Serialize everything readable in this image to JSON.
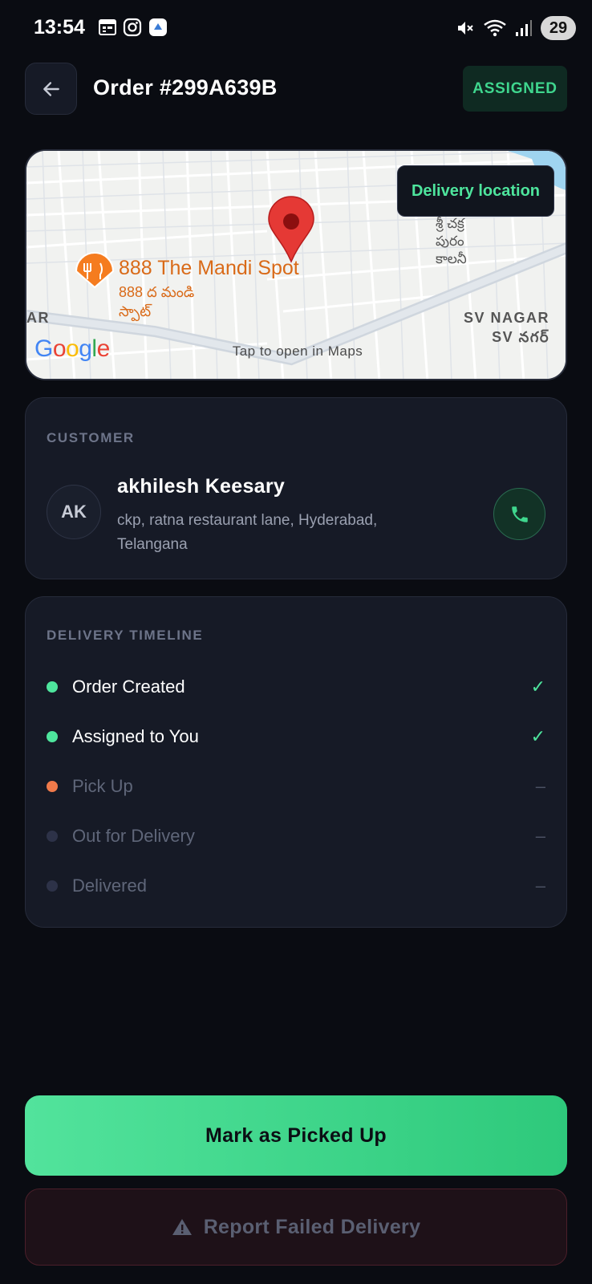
{
  "status_bar": {
    "time": "13:54",
    "battery": "29"
  },
  "header": {
    "order_title": "Order #299A639B",
    "status_badge": "ASSIGNED"
  },
  "map": {
    "badge": "Delivery location",
    "place_name": "888 The Mandi Spot",
    "place_name_local_1": "888 ద మండి",
    "place_name_local_2": "స్పాట్",
    "area_right_en": "SV NAGAR",
    "area_right_local": "SV నగర్",
    "area_left": "AR",
    "telugu_top_1": "శ్రీ చక్ర",
    "telugu_top_2": "పురం",
    "telugu_top_3": "కాలనీ",
    "tap_text": "Tap to open in Maps",
    "logo": {
      "g": "G",
      "o1": "o",
      "o2": "o",
      "g2": "g",
      "l": "l",
      "e": "e"
    }
  },
  "customer": {
    "section_label": "CUSTOMER",
    "initials": "AK",
    "name": "akhilesh Keesary",
    "address": "ckp, ratna restaurant lane, Hyderabad, Telangana"
  },
  "timeline": {
    "section_label": "DELIVERY TIMELINE",
    "steps": [
      {
        "label": "Order Created",
        "mark": "✓",
        "color": "#4ee59d"
      },
      {
        "label": "Assigned to You",
        "mark": "✓",
        "color": "#4ee59d"
      },
      {
        "label": "Pick Up",
        "mark": "–",
        "color": "#f07a4a"
      },
      {
        "label": "Out for Delivery",
        "mark": "–",
        "color": "#2d3248"
      },
      {
        "label": "Delivered",
        "mark": "–",
        "color": "#2d3248"
      }
    ]
  },
  "actions": {
    "primary": "Mark as Picked Up",
    "danger": "Report Failed Delivery"
  },
  "colors": {
    "accent": "#3fd68e",
    "background": "#0a0c12",
    "card": "#161a26"
  }
}
